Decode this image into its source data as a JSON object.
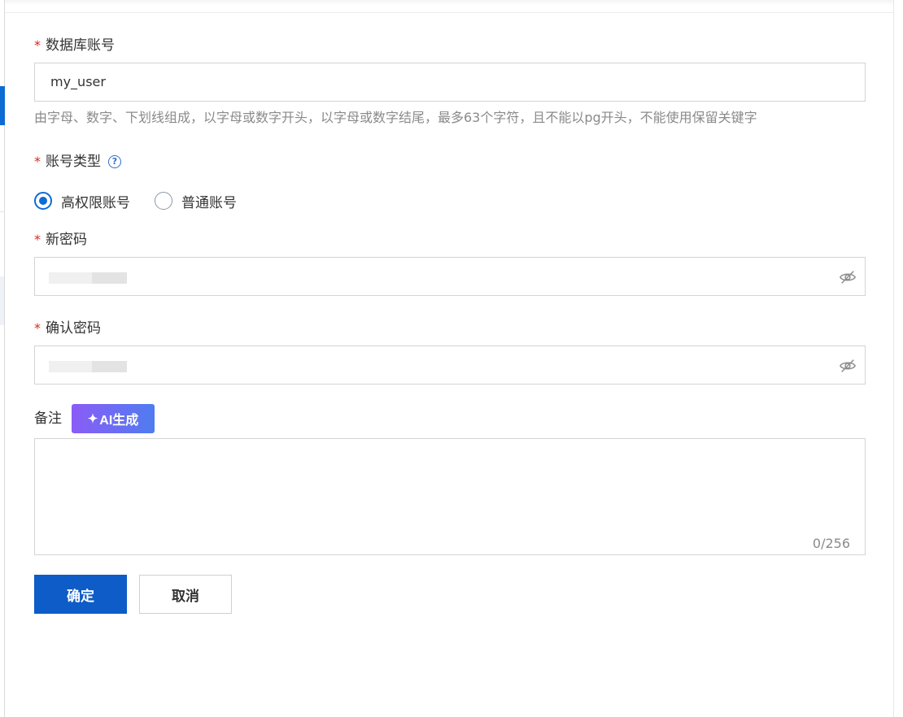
{
  "form": {
    "account": {
      "required_mark": "*",
      "label": "数据库账号",
      "value": "my_user",
      "hint": "由字母、数字、下划线组成，以字母或数字开头，以字母或数字结尾，最多63个字符，且不能以pg开头，不能使用保留关键字"
    },
    "account_type": {
      "required_mark": "*",
      "label": "账号类型",
      "help_icon": "question-circle-icon",
      "options": [
        {
          "label": "高权限账号",
          "checked": true
        },
        {
          "label": "普通账号",
          "checked": false
        }
      ]
    },
    "new_password": {
      "required_mark": "*",
      "label": "新密码",
      "toggle_icon": "eye-off-icon"
    },
    "confirm_password": {
      "required_mark": "*",
      "label": "确认密码",
      "toggle_icon": "eye-off-icon"
    },
    "remark": {
      "label": "备注",
      "ai_button_label": "AI生成",
      "ai_icon": "sparkle-icon",
      "counter": "0/256"
    },
    "actions": {
      "confirm_label": "确定",
      "cancel_label": "取消"
    }
  },
  "colors": {
    "primary": "#0d5cc7",
    "required": "#d9291c",
    "ai_gradient_start": "#8b5cf6",
    "ai_gradient_end": "#4f7cf0"
  }
}
